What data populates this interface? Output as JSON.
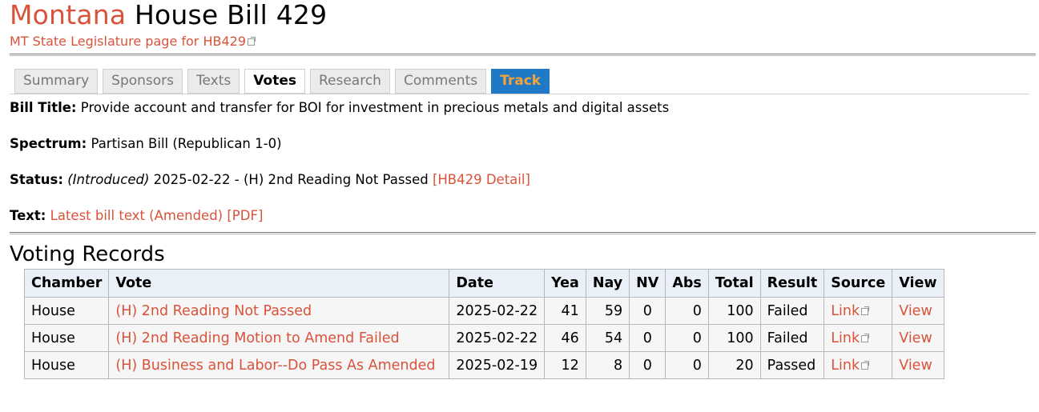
{
  "header": {
    "state": "Montana",
    "bill": "House Bill 429",
    "leg_link": "MT State Legislature page for HB429"
  },
  "tabs": [
    {
      "label": "Summary",
      "state": "normal"
    },
    {
      "label": "Sponsors",
      "state": "normal"
    },
    {
      "label": "Texts",
      "state": "normal"
    },
    {
      "label": "Votes",
      "state": "active"
    },
    {
      "label": "Research",
      "state": "normal"
    },
    {
      "label": "Comments",
      "state": "normal"
    },
    {
      "label": "Track",
      "state": "track"
    }
  ],
  "fields": {
    "title_label": "Bill Title:",
    "title_value": "Provide account and transfer for BOI for investment in precious metals and digital assets",
    "spectrum_label": "Spectrum:",
    "spectrum_value": "Partisan Bill (Republican 1-0)",
    "status_label": "Status:",
    "status_stage": "(Introduced)",
    "status_value": "2025-02-22 - (H) 2nd Reading Not Passed",
    "status_link": "[HB429 Detail]",
    "text_label": "Text:",
    "text_link": "Latest bill text (Amended)",
    "pdf_link": "[PDF]"
  },
  "voting": {
    "heading": "Voting Records",
    "columns": [
      "Chamber",
      "Vote",
      "Date",
      "Yea",
      "Nay",
      "NV",
      "Abs",
      "Total",
      "Result",
      "Source",
      "View"
    ],
    "rows": [
      {
        "chamber": "House",
        "vote": "(H) 2nd Reading Not Passed",
        "date": "2025-02-22",
        "yea": "41",
        "nay": "59",
        "nv": "0",
        "abs": "0",
        "total": "100",
        "result": "Failed",
        "source": "Link",
        "view": "View"
      },
      {
        "chamber": "House",
        "vote": "(H) 2nd Reading Motion to Amend Failed",
        "date": "2025-02-22",
        "yea": "46",
        "nay": "54",
        "nv": "0",
        "abs": "0",
        "total": "100",
        "result": "Failed",
        "source": "Link",
        "view": "View"
      },
      {
        "chamber": "House",
        "vote": "(H) Business and Labor--Do Pass As Amended",
        "date": "2025-02-19",
        "yea": "12",
        "nay": "8",
        "nv": "0",
        "abs": "0",
        "total": "20",
        "result": "Passed",
        "source": "Link",
        "view": "View"
      }
    ]
  },
  "colors": {
    "link": "#d9533b",
    "track_bg": "#1f79c4",
    "track_fg": "#f5a23a",
    "header_bg": "#eaf0f8"
  }
}
